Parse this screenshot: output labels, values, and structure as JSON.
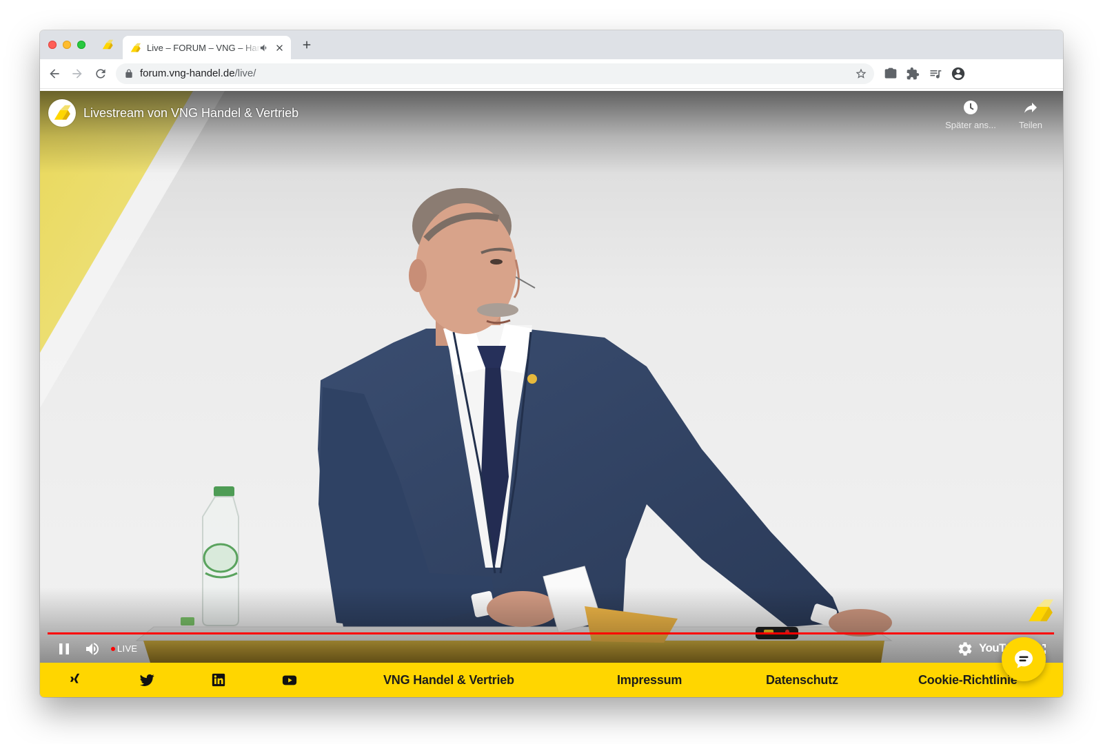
{
  "browser": {
    "window_controls": [
      "close-light",
      "minimize-light",
      "zoom-light"
    ],
    "pinned_tab": {
      "favicon": "vng-logo-icon"
    },
    "tab": {
      "title": "Live – FORUM – VNG – Har",
      "favicon": "vng-logo-icon",
      "audio_icon": "speaker-icon",
      "close_icon": "close-icon"
    },
    "new_tab_icon": "plus-icon",
    "nav_icons": [
      "back-arrow-icon",
      "forward-arrow-icon",
      "reload-icon"
    ],
    "address": {
      "host": "forum.vng-handel.de",
      "path": "/live/",
      "security_icon": "lock-icon",
      "bookmark_icon": "star-icon"
    },
    "toolbar_icons": [
      "camera-icon",
      "puzzle-icon",
      "media-queue-icon",
      "account-icon"
    ]
  },
  "video": {
    "title": "Livestream von VNG Handel & Vertrieb",
    "channel_avatar": "vng-logo-icon",
    "watch_later": {
      "icon": "clock-icon",
      "label": "Später ans..."
    },
    "share": {
      "icon": "share-arrow-icon",
      "label": "Teilen"
    },
    "live_label": "LIVE",
    "progress": 1.0,
    "controls_left": [
      "pause-icon",
      "volume-icon"
    ],
    "controls_right": [
      "settings-gear-icon",
      "youtube-logo",
      "fullscreen-icon"
    ],
    "youtube_logo": "YouTube",
    "watermark": "vng-logo-icon"
  },
  "footer": {
    "social_icons": [
      "xing-icon",
      "twitter-icon",
      "linkedin-icon",
      "youtube-icon"
    ],
    "links": [
      "VNG Handel & Vertrieb",
      "Impressum",
      "Datenschutz",
      "Cookie-Richtlinie"
    ]
  },
  "chat_widget": {
    "icon": "chat-bubble-icon"
  },
  "colors": {
    "brand_yellow": "#ffd600",
    "live_red": "#ff0000",
    "tab_strip": "#dee1e6",
    "omnibox": "#f1f3f4",
    "footer_text": "#1d1d1b"
  }
}
